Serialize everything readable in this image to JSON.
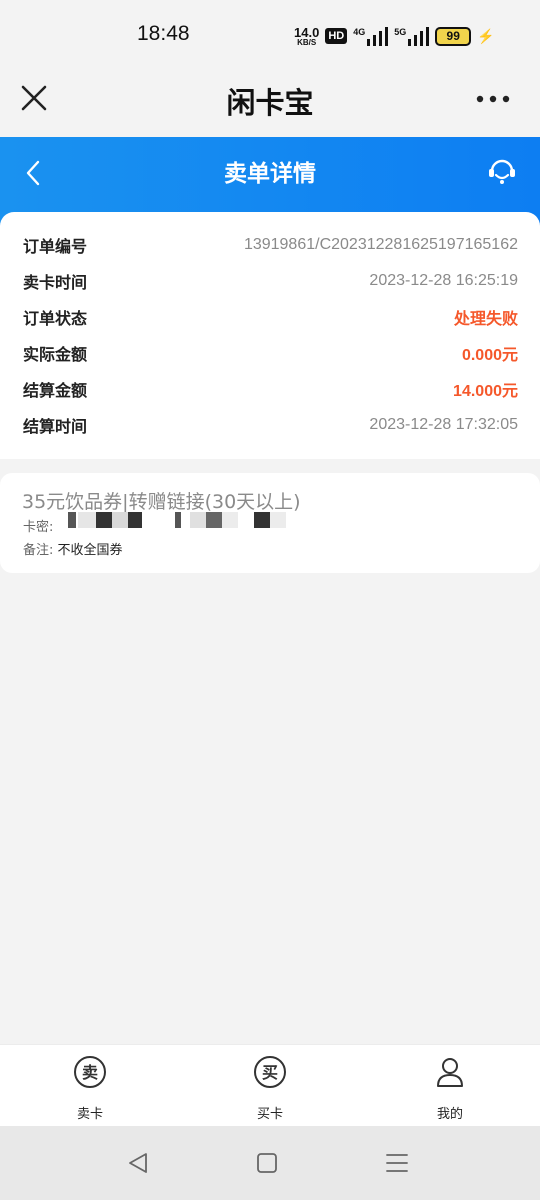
{
  "status_bar": {
    "time": "18:48",
    "net_speed": "14.0",
    "net_speed_unit": "KB/S",
    "hd_label": "HD",
    "signal1_label": "4G",
    "signal2_label": "5G",
    "battery": "99"
  },
  "app_bar": {
    "title": "闲卡宝",
    "close_icon": "close-icon",
    "more_icon": "more-dots-icon"
  },
  "header": {
    "title": "卖单详情",
    "back_icon": "back-chevron-icon",
    "service_icon": "customer-service-icon",
    "color": "#1a92f0"
  },
  "order": {
    "rows": [
      {
        "label": "订单编号",
        "value": "13919861/C20231228162519716516​2"
      },
      {
        "label": "卖卡时间",
        "value": "2023-12-28 16:25:19"
      },
      {
        "label": "订单状态",
        "value": "处理失败"
      },
      {
        "label": "实际金额",
        "value": "0.000元"
      },
      {
        "label": "结算金额",
        "value": "14.000元"
      },
      {
        "label": "结算时间",
        "value": "2023-12-28 17:32:05"
      }
    ],
    "highlight_color": "#f5582b"
  },
  "goods": {
    "title": "35元饮品券|转赠链接(30天以上)",
    "card_key_label": "卡密:",
    "note_label": "备注:",
    "note_value": "不收全国券"
  },
  "tabbar": {
    "items": [
      {
        "label": "卖卡",
        "icon": "sell-card-icon"
      },
      {
        "label": "买卡",
        "icon": "buy-card-icon"
      },
      {
        "label": "我的",
        "icon": "profile-icon"
      }
    ]
  },
  "navbar": {
    "icons": [
      "nav-back-icon",
      "nav-home-icon",
      "nav-menu-icon"
    ]
  }
}
